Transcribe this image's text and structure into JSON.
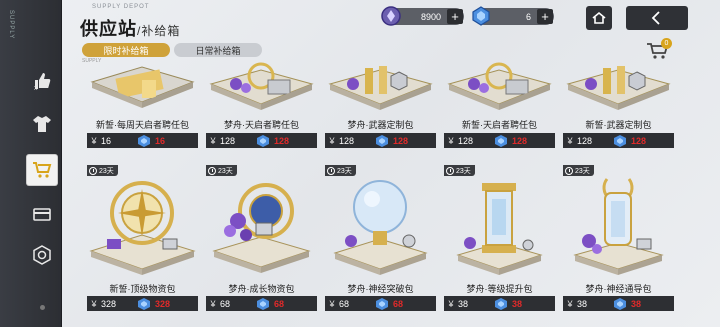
{
  "rail": {
    "tag": "SUPPLY",
    "items": [
      {
        "name": "thumbs-up-icon"
      },
      {
        "name": "shirt-icon"
      },
      {
        "name": "cart-icon"
      },
      {
        "name": "card-icon"
      },
      {
        "name": "badge-icon"
      }
    ]
  },
  "header": {
    "title": "供应站",
    "subtitle": "/补给箱",
    "title_en": "SUPPLY DEPOT"
  },
  "currency": {
    "coin_value": "8900",
    "gem_value": "6"
  },
  "tabs": {
    "limited": "限时补给箱",
    "daily": "日常补给箱",
    "tag": "SUPPLY"
  },
  "cart": {
    "count": "0"
  },
  "row1": [
    {
      "name": "新誓·每周天启者聘任包",
      "price": "16",
      "gem": "16"
    },
    {
      "name": "梦舟·天启者聘任包",
      "price": "128",
      "gem": "128"
    },
    {
      "name": "梦舟·武器定制包",
      "price": "128",
      "gem": "128"
    },
    {
      "name": "新誓·天启者聘任包",
      "price": "128",
      "gem": "128"
    },
    {
      "name": "新誓·武器定制包",
      "price": "128",
      "gem": "128"
    }
  ],
  "row2": [
    {
      "timer": "23天",
      "name": "新誓·顶级物资包",
      "price": "328",
      "gem": "328"
    },
    {
      "timer": "23天",
      "name": "梦舟·成长物资包",
      "price": "68",
      "gem": "68"
    },
    {
      "timer": "23天",
      "name": "梦舟·神经突破包",
      "price": "68",
      "gem": "68"
    },
    {
      "timer": "23天",
      "name": "梦舟·等级提升包",
      "price": "38",
      "gem": "38"
    },
    {
      "timer": "23天",
      "name": "梦舟·神经通导包",
      "price": "38",
      "gem": "38"
    }
  ],
  "yen": "¥",
  "colors": {
    "accent": "#cfa23a",
    "gem_price": "#e02a2a",
    "rail": "#2c2e33"
  }
}
